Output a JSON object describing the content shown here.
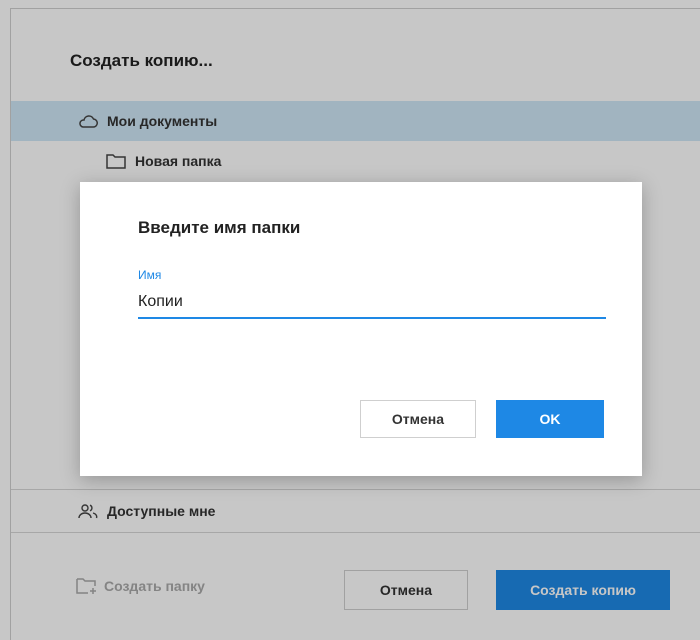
{
  "base_dialog": {
    "title": "Создать копию...",
    "tree": {
      "root_label": "Мои документы",
      "root_icon": "cloud-icon",
      "folder_label": "Новая папка",
      "folder_icon": "folder-icon",
      "shared_label": "Доступные мне",
      "shared_icon": "users-icon"
    },
    "footer": {
      "create_folder_label": "Создать папку",
      "create_folder_icon": "folder-plus-icon",
      "cancel_label": "Отмена",
      "primary_label": "Создать копию"
    }
  },
  "modal": {
    "title": "Введите имя папки",
    "field": {
      "label": "Имя",
      "value": "Копии"
    },
    "cancel_label": "Отмена",
    "ok_label": "OK"
  },
  "colors": {
    "accent": "#1e88e5",
    "selected_row": "#cfe7f6",
    "disabled_text": "#a9a9a9"
  }
}
